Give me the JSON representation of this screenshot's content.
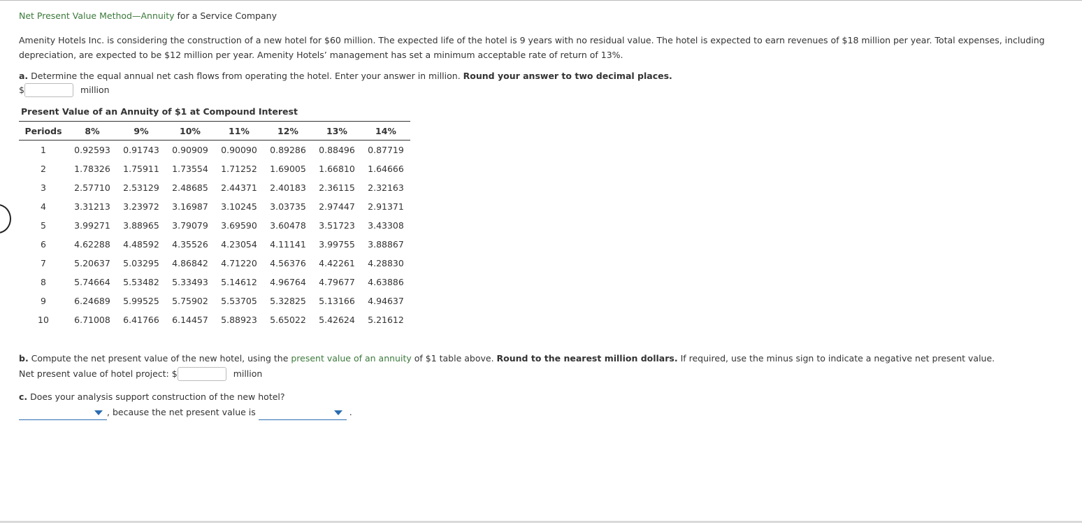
{
  "header": {
    "title_link": "Net Present Value Method—Annuity",
    "title_rest": " for a Service Company"
  },
  "intro": {
    "text": "Amenity Hotels Inc. is considering the construction of a new hotel for $60 million. The expected life of the hotel is 9 years with no residual value. The hotel is expected to earn revenues of $18 million per year. Total expenses, including depreciation, are expected to be $12 million per year. Amenity Hotels’ management has set a minimum acceptable rate of return of 13%."
  },
  "part_a": {
    "label": "a.",
    "text": " Determine the equal annual net cash flows from operating the hotel. Enter your answer in million. ",
    "bold": "Round your answer to two decimal places.",
    "currency": "$",
    "value": "",
    "unit": "million"
  },
  "table": {
    "title": "Present Value of an Annuity of $1 at Compound Interest",
    "headers": [
      "Periods",
      "8%",
      "9%",
      "10%",
      "11%",
      "12%",
      "13%",
      "14%"
    ],
    "rows": [
      [
        "1",
        "0.92593",
        "0.91743",
        "0.90909",
        "0.90090",
        "0.89286",
        "0.88496",
        "0.87719"
      ],
      [
        "2",
        "1.78326",
        "1.75911",
        "1.73554",
        "1.71252",
        "1.69005",
        "1.66810",
        "1.64666"
      ],
      [
        "3",
        "2.57710",
        "2.53129",
        "2.48685",
        "2.44371",
        "2.40183",
        "2.36115",
        "2.32163"
      ],
      [
        "4",
        "3.31213",
        "3.23972",
        "3.16987",
        "3.10245",
        "3.03735",
        "2.97447",
        "2.91371"
      ],
      [
        "5",
        "3.99271",
        "3.88965",
        "3.79079",
        "3.69590",
        "3.60478",
        "3.51723",
        "3.43308"
      ],
      [
        "6",
        "4.62288",
        "4.48592",
        "4.35526",
        "4.23054",
        "4.11141",
        "3.99755",
        "3.88867"
      ],
      [
        "7",
        "5.20637",
        "5.03295",
        "4.86842",
        "4.71220",
        "4.56376",
        "4.42261",
        "4.28830"
      ],
      [
        "8",
        "5.74664",
        "5.53482",
        "5.33493",
        "5.14612",
        "4.96764",
        "4.79677",
        "4.63886"
      ],
      [
        "9",
        "6.24689",
        "5.99525",
        "5.75902",
        "5.53705",
        "5.32825",
        "5.13166",
        "4.94637"
      ],
      [
        "10",
        "6.71008",
        "6.41766",
        "6.14457",
        "5.88923",
        "5.65022",
        "5.42624",
        "5.21612"
      ]
    ]
  },
  "part_b": {
    "label": "b.",
    "text1": " Compute the net present value of the new hotel, using the ",
    "link": "present value of an annuity",
    "text2": " of $1 table above. ",
    "bold": "Round to the nearest million dollars.",
    "text3": " If required, use the minus sign to indicate a negative net present value.",
    "field_label": "Net present value of hotel project: $",
    "value": "",
    "unit": "million"
  },
  "part_c": {
    "label": "c.",
    "text": " Does your analysis support construction of the new hotel?",
    "select1_value": "",
    "middle_text": ", because the net present value is",
    "select2_value": "",
    "end": "."
  },
  "colors": {
    "link_green": "#3c7a3c",
    "select_blue": "#2b6cb0"
  }
}
